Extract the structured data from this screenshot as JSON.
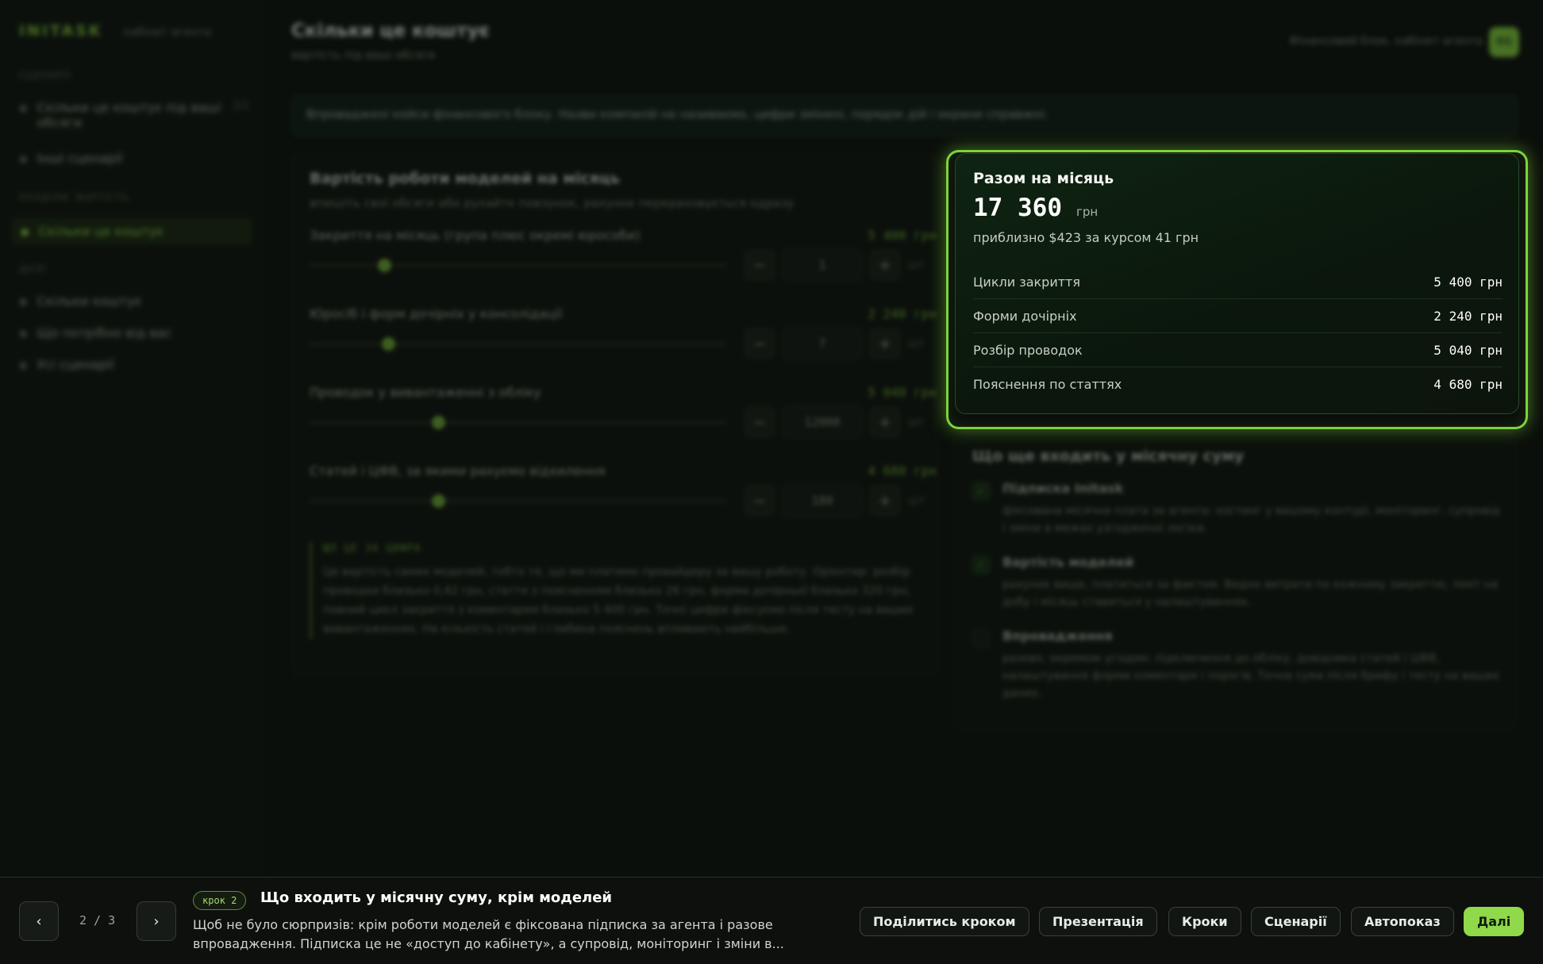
{
  "sidebar": {
    "logo": "INITASK",
    "logo_sub": "кабінет агента",
    "groups": [
      {
        "label": "СЦЕНАРІЇ",
        "items": [
          {
            "label": "Скільки це коштує під ваші обсяги",
            "count": "1/1"
          },
          {
            "label": "Інші сценарії"
          }
        ]
      },
      {
        "label": "РОЗДІЛИ: ВАРТІСТЬ",
        "items": [
          {
            "label": "Скільки це коштує",
            "active": true
          }
        ]
      },
      {
        "label": "ДАЛІ",
        "items": [
          {
            "label": "Скільки коштує"
          },
          {
            "label": "Що потрібно від вас"
          },
          {
            "label": "Усі сценарії"
          }
        ]
      }
    ]
  },
  "header": {
    "title": "Скільки це коштує",
    "subtitle": "вартість під ваші обсяги",
    "context": "Фінансовий блок, кабінет агента",
    "avatar": "ФБ"
  },
  "banner": "Впроваджені кейси фінансового блоку. Назви компаній не називаємо, цифри змінені, порядок дій і екрани справжні.",
  "calculator": {
    "title": "Вартість роботи моделей на місяць",
    "subtitle": "впишіть свої обсяги або рухайте повзунок, рахунок перераховується одразу",
    "params": [
      {
        "label": "Закриття на місяць (група плюс окремі юрособи)",
        "cost": "5 400 грн",
        "value": "1",
        "unit": "шт",
        "level": 0.18
      },
      {
        "label": "Юросіб і форм дочірніх у консолідації",
        "cost": "2 240 грн",
        "value": "7",
        "unit": "шт",
        "level": 0.19
      },
      {
        "label": "Проводок у вивантаженні з обліку",
        "cost": "5 040 грн",
        "value": "12000",
        "unit": "шт",
        "level": 0.31
      },
      {
        "label": "Статей і ЦФВ, за якими рахуємо відхилення",
        "cost": "4 680 грн",
        "value": "180",
        "unit": "шт",
        "level": 0.31
      }
    ],
    "note_head": "ЩО ЦЕ ЗА ЦИФРА",
    "note_body": "Це вартість самих моделей, тобто те, що ми платимо провайдеру за вашу роботу. Орієнтир: розбір проводки близько 0,42 грн, стаття з поясненням близько 26 грн, форма дочірньої близько 320 грн, повний цикл закриття з коментарем близько 5 400 грн. Точні цифри фіксуємо після тесту на ваших вивантаженнях. На кількість статей і глибина пояснень впливають найбільше."
  },
  "summary": {
    "title": "Разом на місяць",
    "total": "17 360",
    "currency": "грн",
    "approx": "приблизно $423 за курсом 41 грн",
    "rows": [
      {
        "label": "Цикли закриття",
        "value": "5 400 грн"
      },
      {
        "label": "Форми дочірніх",
        "value": "2 240 грн"
      },
      {
        "label": "Розбір проводок",
        "value": "5 040 грн"
      },
      {
        "label": "Пояснення по статтях",
        "value": "4 680 грн"
      }
    ]
  },
  "included": {
    "title": "Що ще входить у місячну суму",
    "items": [
      {
        "name": "Підписка Initask",
        "desc": "фіксована місячна плата за агента: хостинг у вашому контурі, моніторинг, супровід і зміни в межах узгодженої логіки.",
        "checked": true
      },
      {
        "name": "Вартість моделей",
        "desc": "рахунок вище, платиться за фактом. Видно витрати по кожному закриттю, ліміт на добу і місяць ставиться у налаштуваннях.",
        "checked": true
      },
      {
        "name": "Впровадження",
        "desc": "разово, окремою угодою: підключення до обліку, довідника статей і ЦФВ, налаштування форми коментаря і порогів. Точна сума після брифу і тесту на ваших даних.",
        "checked": false
      }
    ]
  },
  "tour": {
    "prev_icon": "chevron-left-icon",
    "next_icon": "chevron-right-icon",
    "page": "2 / 3",
    "step_badge": "крок 2",
    "title": "Що входить у місячну суму, крім моделей",
    "text": "Щоб не було сюрпризів: крім роботи моделей є фіксована підписка за агента і разове впровадження. Підписка це не «доступ до кабінету», а супровід, моніторинг і зміни в...",
    "buttons": {
      "share": "Поділитись кроком",
      "presentation": "Презентація",
      "steps": "Кроки",
      "scenarios": "Сценарії",
      "autoplay": "Автопоказ",
      "next": "Далі"
    }
  },
  "colors": {
    "accent": "#8fd94a",
    "highlight": "#7dd33c",
    "background": "#0b0f0b"
  }
}
